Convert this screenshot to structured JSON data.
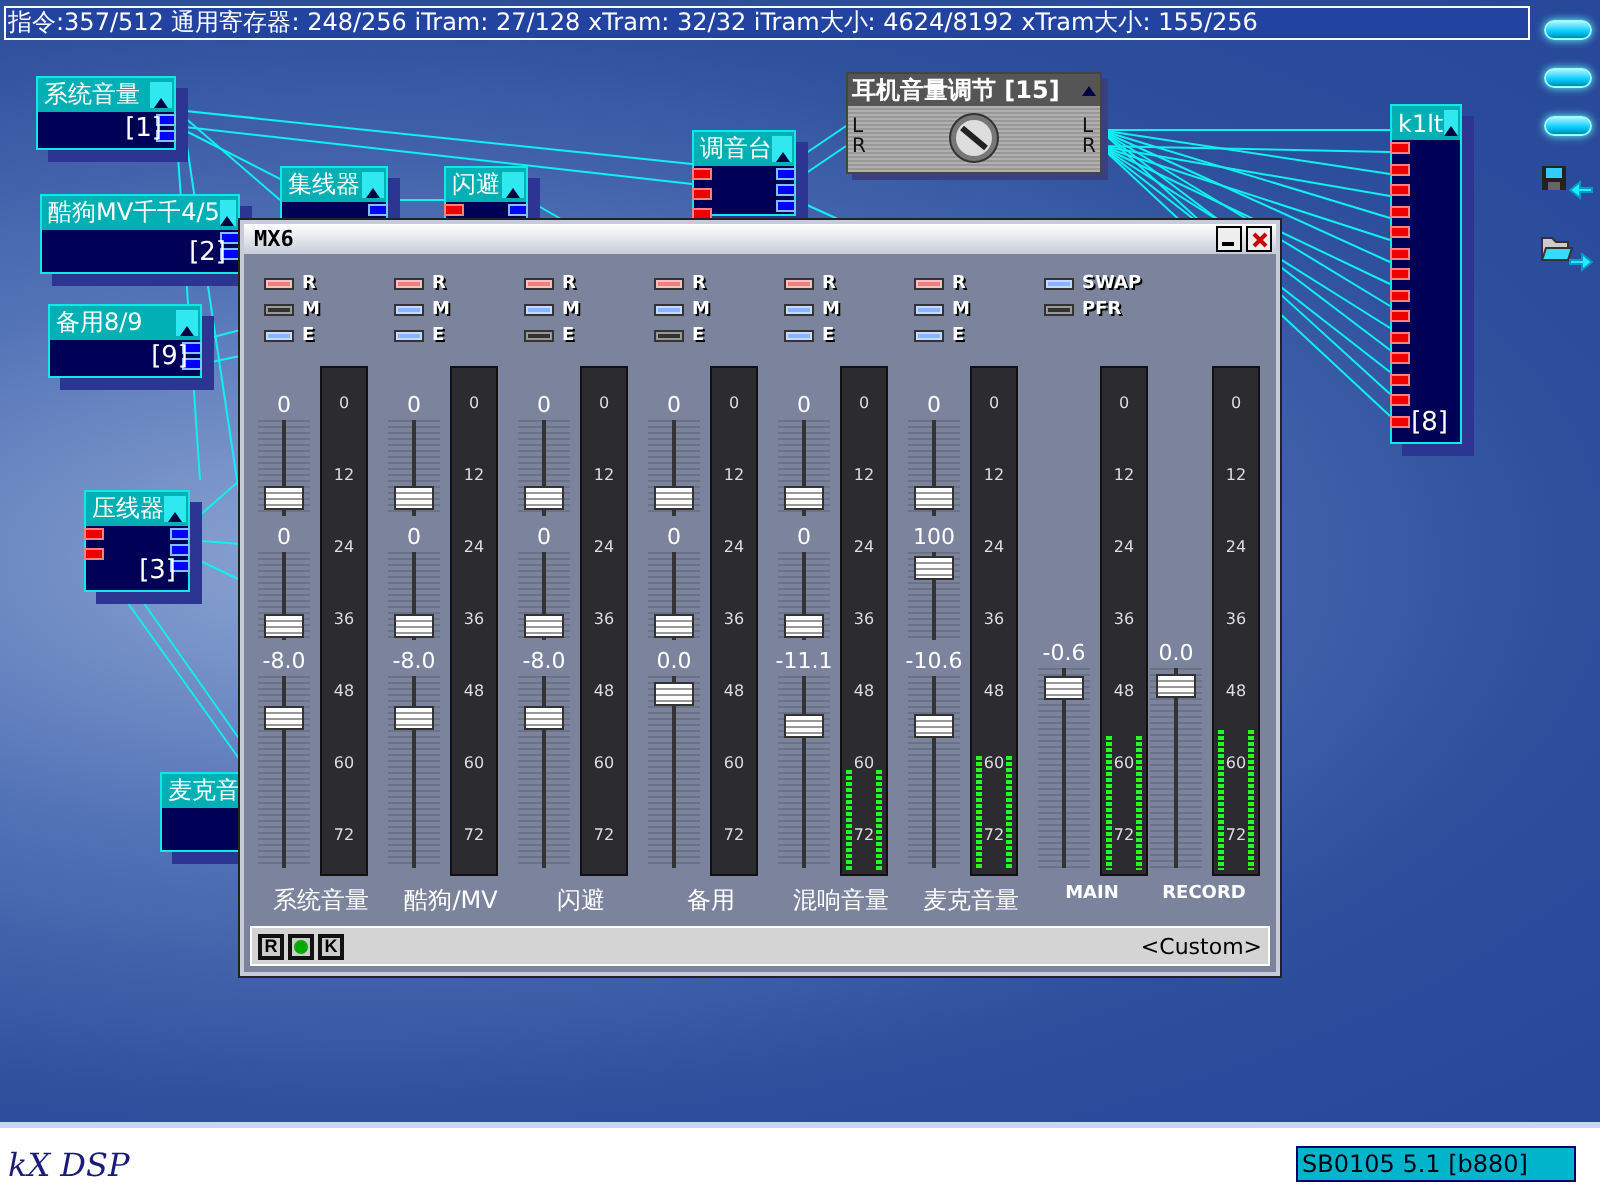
{
  "status_bar": {
    "text": "指令:357/512 通用寄存器: 248/256 iTram: 27/128 xTram: 32/32 iTram大小: 4624/8192 xTram大小: 155/256"
  },
  "nodes": [
    {
      "kind": "module",
      "title": "系统音量",
      "number": "[1]"
    },
    {
      "kind": "module",
      "title": "酷狗MV千千4/5",
      "number": "[2]"
    },
    {
      "kind": "module",
      "title": "备用8/9",
      "number": "[9]"
    },
    {
      "kind": "module",
      "title": "集线器"
    },
    {
      "kind": "module",
      "title": "闪避"
    },
    {
      "kind": "module",
      "title": "调音台"
    },
    {
      "kind": "knob",
      "title": "耳机音量调节 [15]",
      "inputs": [
        "L",
        "R"
      ],
      "outputs": [
        "L",
        "R"
      ]
    },
    {
      "kind": "module",
      "title": "k1lt",
      "number": "[8]"
    },
    {
      "kind": "module",
      "title": "压线器",
      "number": "[3]"
    },
    {
      "kind": "module",
      "title": "麦克音"
    }
  ],
  "mixer": {
    "title": "MX6",
    "channels": [
      {
        "name": "系统音量",
        "toggles": [
          {
            "kind": "record",
            "label": "R",
            "on": true
          },
          {
            "kind": "switch",
            "label": "M",
            "on": false
          },
          {
            "kind": "switch",
            "label": "E",
            "on": true
          }
        ],
        "faders": [
          {
            "value": "0",
            "level": 0.1
          },
          {
            "value": "0",
            "level": 0.05
          },
          {
            "value": "-8.0",
            "level": 0.82
          }
        ],
        "meter": {
          "scale": [
            "0",
            "12",
            "24",
            "36",
            "48",
            "60",
            "72"
          ]
        }
      },
      {
        "name": "酷狗/MV",
        "toggles": [
          {
            "kind": "record",
            "label": "R",
            "on": true
          },
          {
            "kind": "switch",
            "label": "M",
            "on": true
          },
          {
            "kind": "switch",
            "label": "E",
            "on": true
          }
        ],
        "faders": [
          {
            "value": "0",
            "level": 0.1
          },
          {
            "value": "0",
            "level": 0.05
          },
          {
            "value": "-8.0",
            "level": 0.82
          }
        ],
        "meter": {
          "scale": [
            "0",
            "12",
            "24",
            "36",
            "48",
            "60",
            "72"
          ]
        }
      },
      {
        "name": "闪避",
        "toggles": [
          {
            "kind": "record",
            "label": "R",
            "on": true
          },
          {
            "kind": "switch",
            "label": "M",
            "on": true
          },
          {
            "kind": "switch",
            "label": "E",
            "on": false
          }
        ],
        "faders": [
          {
            "value": "0",
            "level": 0.1
          },
          {
            "value": "0",
            "level": 0.05
          },
          {
            "value": "-8.0",
            "level": 0.82
          }
        ],
        "meter": {
          "scale": [
            "0",
            "12",
            "24",
            "36",
            "48",
            "60",
            "72"
          ]
        }
      },
      {
        "name": "备用",
        "toggles": [
          {
            "kind": "record",
            "label": "R",
            "on": true
          },
          {
            "kind": "switch",
            "label": "M",
            "on": true
          },
          {
            "kind": "switch",
            "label": "E",
            "on": false
          }
        ],
        "faders": [
          {
            "value": "0",
            "level": 0.1
          },
          {
            "value": "0",
            "level": 0.05
          },
          {
            "value": "0.0",
            "level": 0.97
          }
        ],
        "meter": {
          "scale": [
            "0",
            "12",
            "24",
            "36",
            "48",
            "60",
            "72"
          ]
        }
      },
      {
        "name": "混响音量",
        "toggles": [
          {
            "kind": "record",
            "label": "R",
            "on": true
          },
          {
            "kind": "switch",
            "label": "M",
            "on": true
          },
          {
            "kind": "switch",
            "label": "E",
            "on": true
          }
        ],
        "faders": [
          {
            "value": "0",
            "level": 0.1
          },
          {
            "value": "0",
            "level": 0.05
          },
          {
            "value": "-11.1",
            "level": 0.77
          }
        ],
        "meter": {
          "level": 0.2,
          "scale": [
            "0",
            "12",
            "24",
            "36",
            "48",
            "60",
            "72"
          ]
        }
      },
      {
        "name": "麦克音量",
        "toggles": [
          {
            "kind": "record",
            "label": "R",
            "on": true
          },
          {
            "kind": "switch",
            "label": "M",
            "on": true
          },
          {
            "kind": "switch",
            "label": "E",
            "on": true
          }
        ],
        "faders": [
          {
            "value": "0",
            "level": 0.1
          },
          {
            "value": "100",
            "level": 0.95
          },
          {
            "value": "-10.6",
            "level": 0.77
          }
        ],
        "meter": {
          "level": 0.23,
          "scale": [
            "0",
            "12",
            "24",
            "36",
            "48",
            "60",
            "72"
          ]
        }
      }
    ],
    "masters": [
      {
        "name": "MAIN",
        "toggles": [
          {
            "kind": "switch",
            "label": "SWAP",
            "on": true
          },
          {
            "kind": "switch",
            "label": "PFR",
            "on": false
          }
        ],
        "faders": [
          {
            "value": "-0.6",
            "level": 0.96
          }
        ],
        "meter": {
          "level": 0.27,
          "scale": [
            "0",
            "12",
            "24",
            "36",
            "48",
            "60",
            "72"
          ]
        }
      },
      {
        "name": "RECORD",
        "faders": [
          {
            "value": "0.0",
            "level": 0.97
          }
        ],
        "meter": {
          "level": 0.28,
          "scale": [
            "0",
            "12",
            "24",
            "36",
            "48",
            "60",
            "72"
          ]
        }
      }
    ],
    "footer_buttons": [
      {
        "kind": "text",
        "label": "R"
      },
      {
        "kind": "dot"
      },
      {
        "kind": "text",
        "label": "K"
      }
    ],
    "preset": "<Custom>"
  },
  "footer": {
    "logo": "kX DSP",
    "device": "SB0105 5.1 [b880]"
  }
}
